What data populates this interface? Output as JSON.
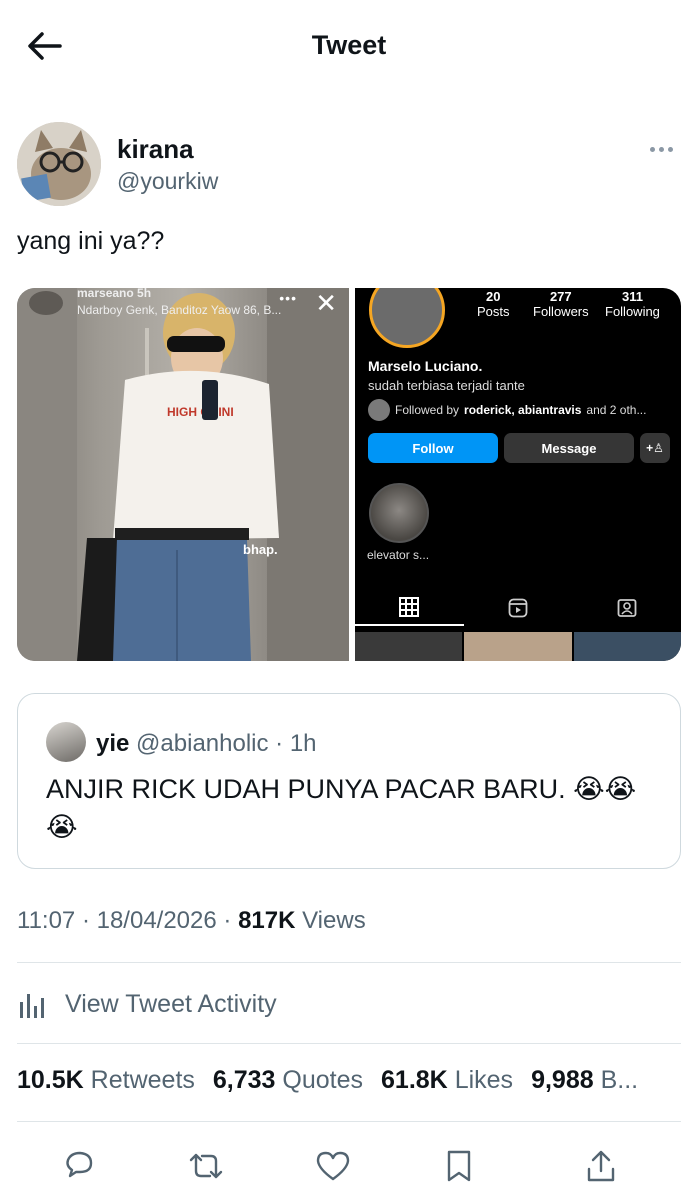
{
  "header": {
    "title": "Tweet"
  },
  "author": {
    "name": "kirana",
    "handle": "@yourkiw"
  },
  "tweet": {
    "text": "yang ini ya??"
  },
  "media": {
    "story": {
      "user": "marseano 5h",
      "subtitle": "Ndarboy Genk, Banditoz Yaow 86, B...",
      "sticker": "bhap."
    },
    "profile": {
      "posts_count": "20",
      "posts_label": "Posts",
      "followers_count": "277",
      "followers_label": "Followers",
      "following_count": "311",
      "following_label": "Following",
      "name": "Marselo Luciano.",
      "bio": "sudah terbiasa terjadi tante",
      "followed_prefix": "Followed by",
      "followed_names": "roderick, abiantravis",
      "followed_suffix": "and 2 oth...",
      "follow_label": "Follow",
      "message_label": "Message",
      "highlight_label": "elevator s..."
    }
  },
  "quote": {
    "name": "yie",
    "handle_time": "@abianholic · 1h",
    "text": "ANJIR RICK UDAH PUNYA PACAR BARU. 😭😭😭"
  },
  "meta": {
    "time_date": "11:07 · 18/04/2026 ·",
    "views_count": "817K",
    "views_label": "Views"
  },
  "activity": {
    "label": "View Tweet Activity"
  },
  "stats": {
    "retweets_count": "10.5K",
    "retweets_label": "Retweets",
    "quotes_count": "6,733",
    "quotes_label": "Quotes",
    "likes_count": "61.8K",
    "likes_label": "Likes",
    "bookmarks_count": "9,988",
    "bookmarks_label": "B..."
  },
  "icons": {
    "back": "arrow-left-icon",
    "more": "more-horizontal-icon",
    "activity": "bar-chart-icon",
    "reply": "reply-icon",
    "retweet": "retweet-icon",
    "like": "heart-icon",
    "bookmark": "bookmark-icon",
    "share": "share-icon"
  },
  "colors": {
    "text": "#0f1419",
    "secondary": "#536471",
    "border": "#cfd9de",
    "ig_follow": "#0095f6"
  }
}
